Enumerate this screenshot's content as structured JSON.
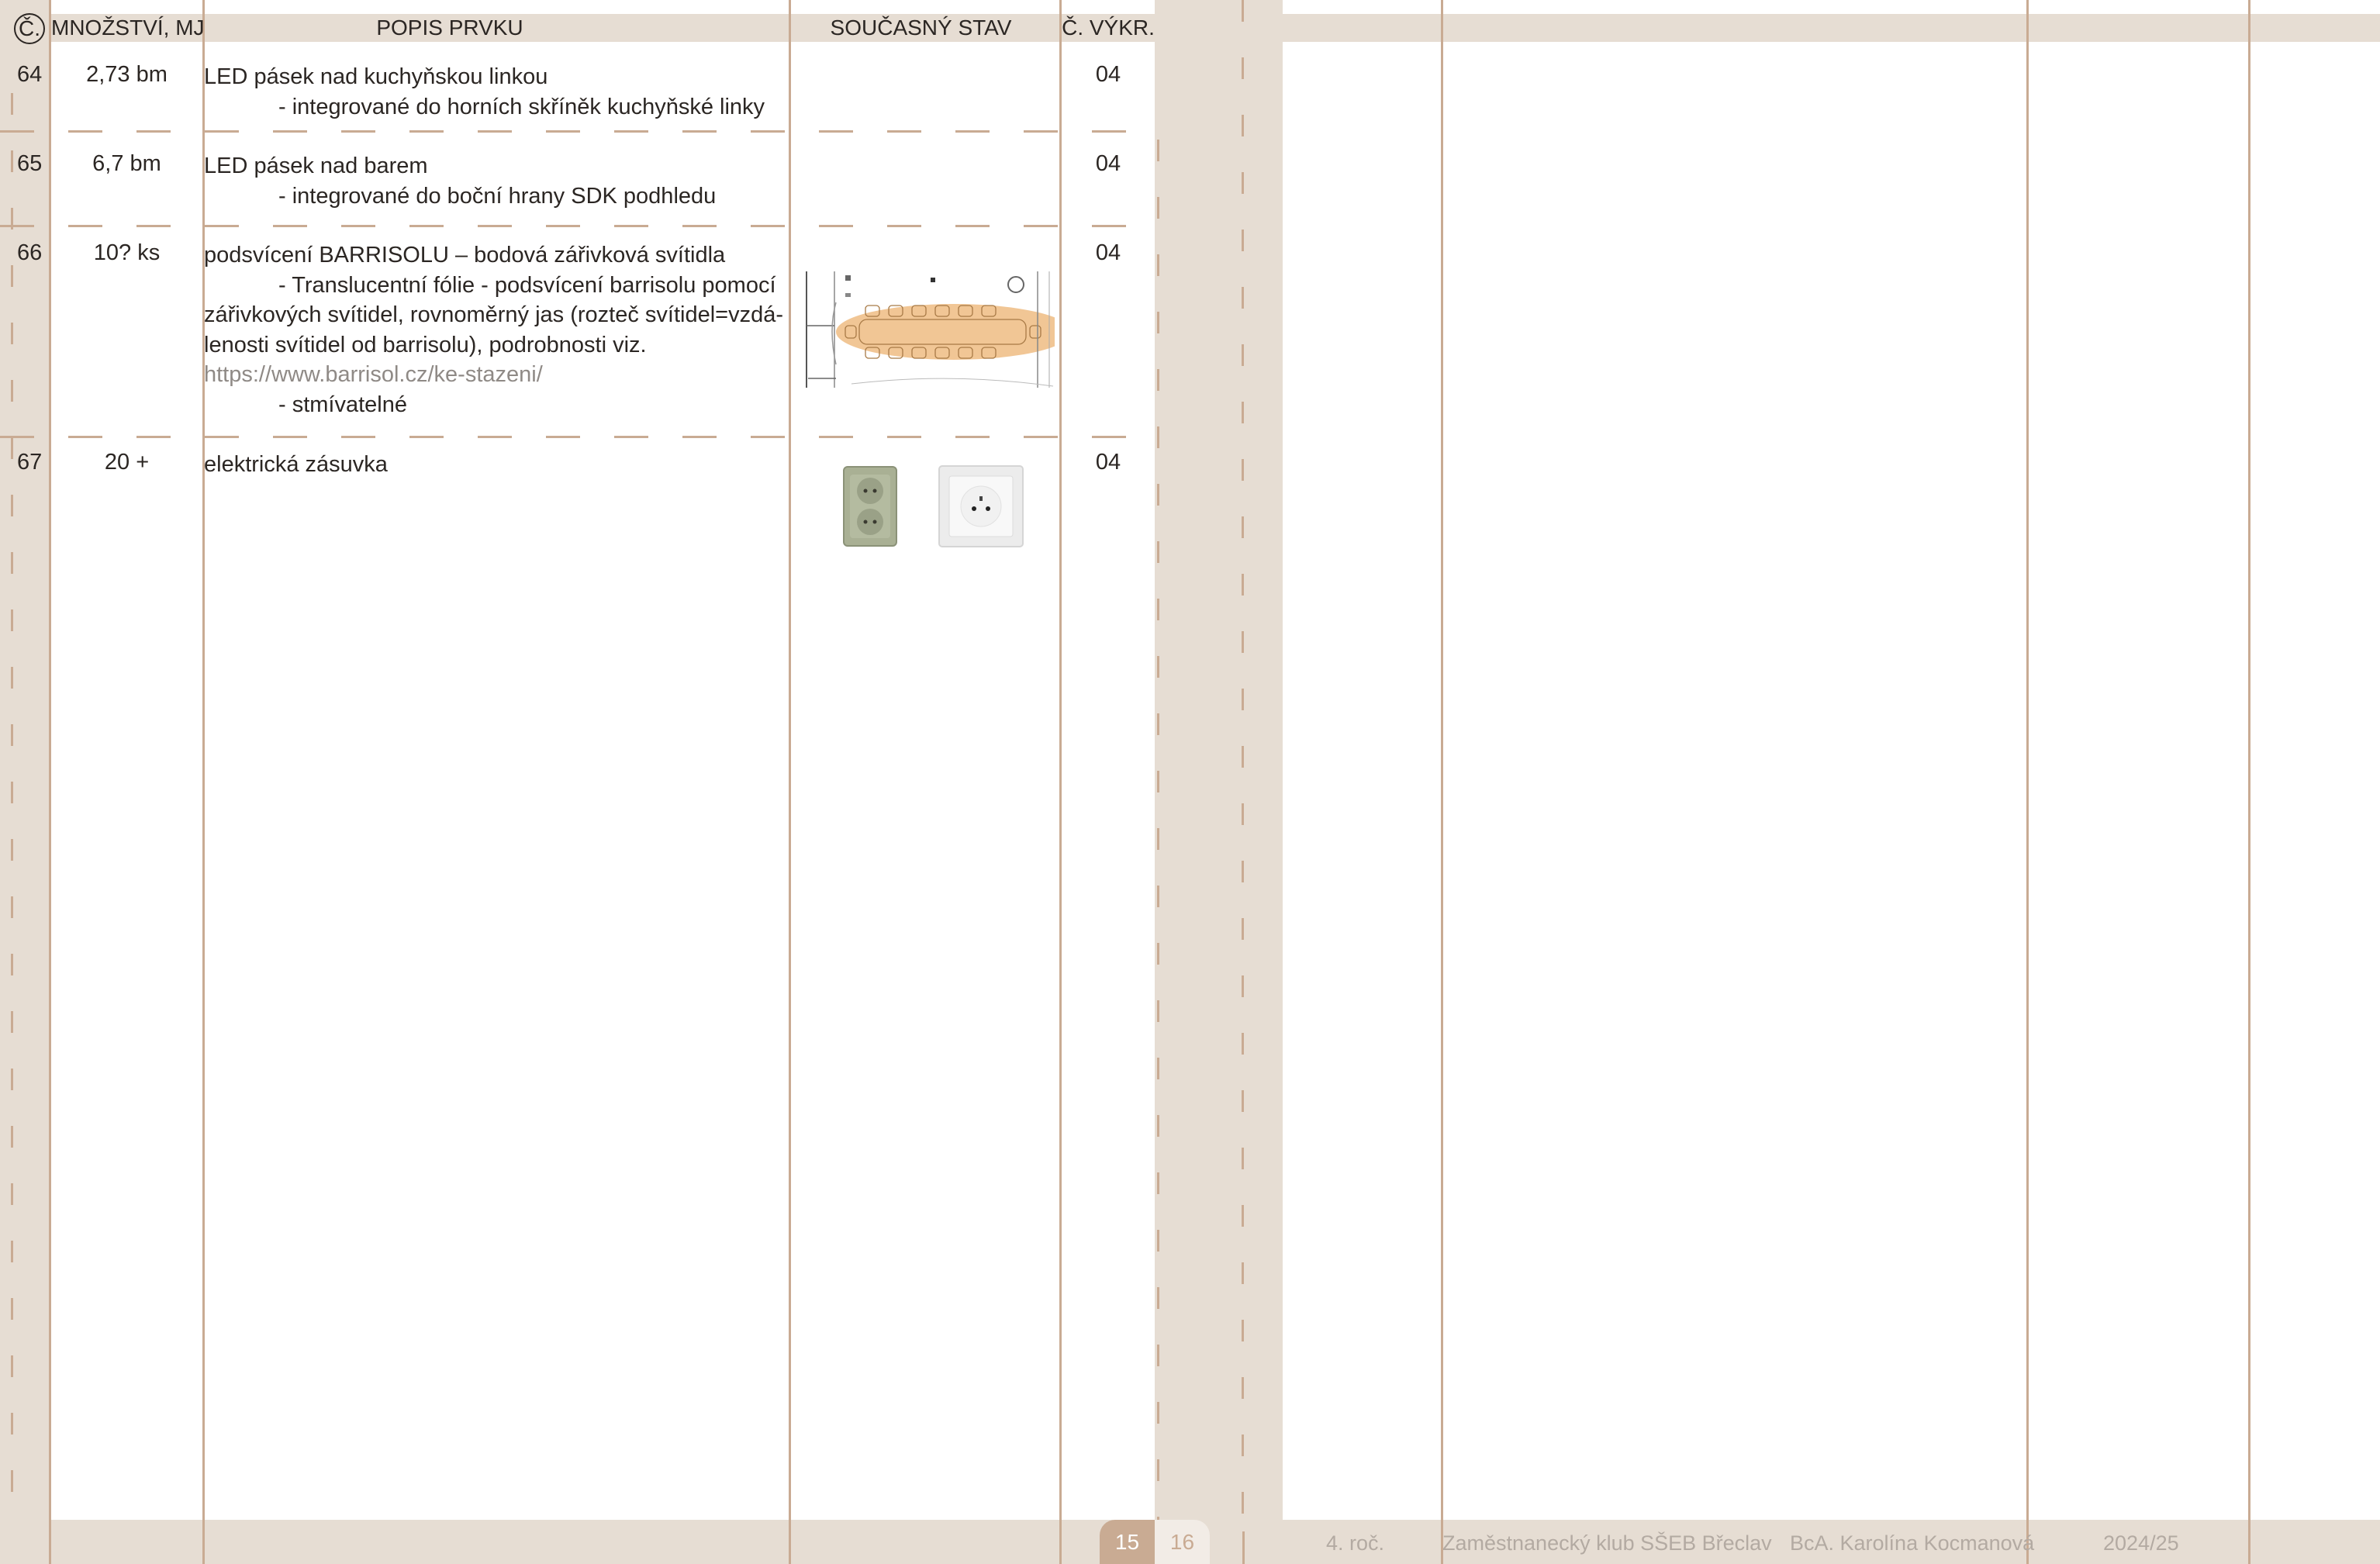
{
  "header": {
    "no_label": "Č.",
    "qty_label": "MNOŽSTVÍ, MJ",
    "desc_label": "POPIS PRVKU",
    "state_label": "SOUČASNÝ STAV",
    "drawing_label": "Č. VÝKR."
  },
  "rows": [
    {
      "no": "64",
      "qty": "2,73 bm",
      "title": "LED pásek nad kuchyňskou linkou",
      "line1": "- integrované do horních skříněk kuchyňské linky",
      "drawing": "04"
    },
    {
      "no": "65",
      "qty": "6,7 bm",
      "title": "LED pásek nad barem",
      "line1": "- integrované do boční hrany SDK podhledu",
      "drawing": "04"
    },
    {
      "no": "66",
      "qty": "10? ks",
      "title": "podsvícení BARRISOLU – bodová zářivková svítidla",
      "line1": "- Translucentní fólie - podsvícení barrisolu pomocí",
      "line2": "zářivkových svítidel, rovnoměrný jas (rozteč svítidel=vzdá-",
      "line3": "lenosti svítidel od barrisolu), podrobnosti viz.",
      "link": "https://www.barrisol.cz/ke-stazeni/",
      "line4": "- stmívatelné",
      "drawing": "04",
      "image": "floor-plan-thumbnail"
    },
    {
      "no": "67",
      "qty": "20 +",
      "title": "elektrická zásuvka",
      "drawing": "04",
      "images": [
        "double-socket-photo",
        "single-socket-photo"
      ]
    }
  ],
  "footer": {
    "page_left": "15",
    "page_right": "16",
    "year": "4. roč.",
    "project": "Zaměstnanecký klub SŠEB Břeclav",
    "author": "BcA. Karolína Kocmanová",
    "school_year": "2024/25"
  },
  "colors": {
    "band": "#e6ddd3",
    "line": "#c9ab93",
    "page_active": "#c9ab93",
    "page_inactive": "#f2ece6"
  }
}
